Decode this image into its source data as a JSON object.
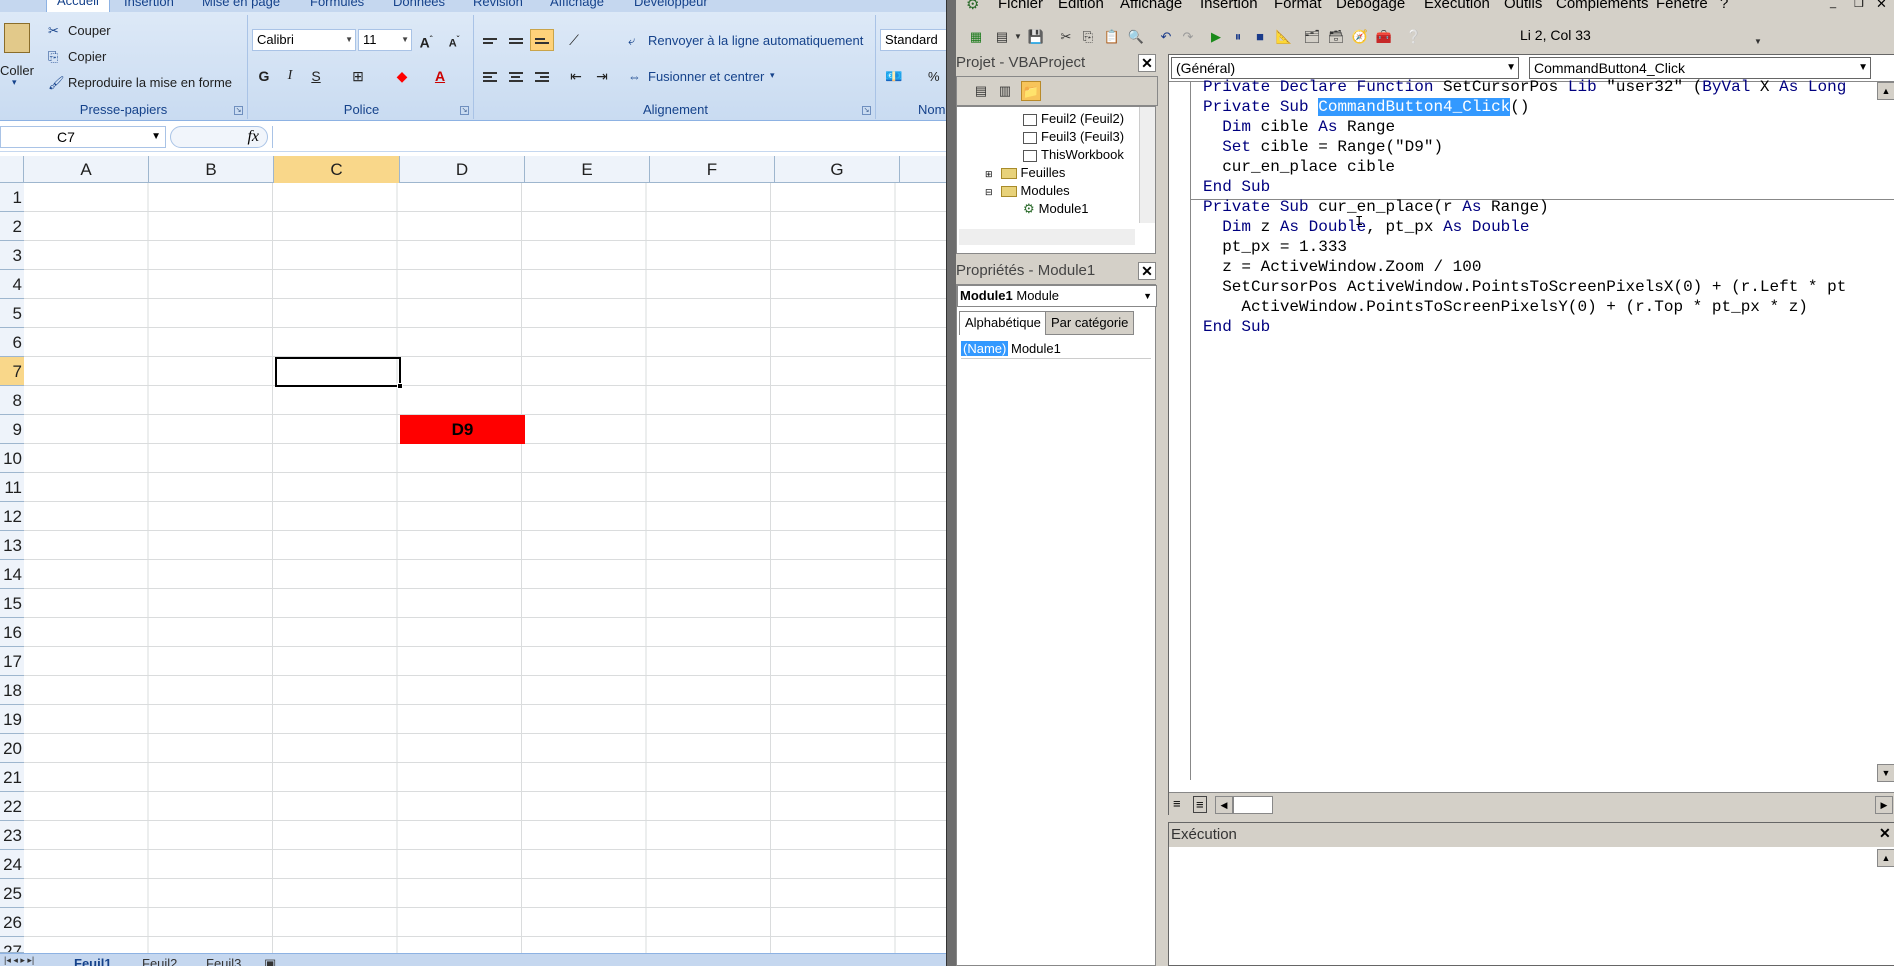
{
  "excel": {
    "ribbon_tabs": [
      "Accueil",
      "Insertion",
      "Mise en page",
      "Formules",
      "Données",
      "Révision",
      "Affichage",
      "Développeur"
    ],
    "clipboard": {
      "paste": "Coller",
      "cut": "Couper",
      "copy": "Copier",
      "format_painter": "Reproduire la mise en forme",
      "label": "Presse-papiers"
    },
    "font": {
      "name": "Calibri",
      "size": "11",
      "bold": "G",
      "italic": "I",
      "underline": "S",
      "label": "Police"
    },
    "alignment": {
      "wrap": "Renvoyer à la ligne automatiquement",
      "merge": "Fusionner et centrer",
      "label": "Alignement"
    },
    "number": {
      "format": "Standard",
      "percent": "%",
      "label": "Nom"
    },
    "name_box": "C7",
    "fx": "fx",
    "columns": [
      "A",
      "B",
      "C",
      "D",
      "E",
      "F",
      "G"
    ],
    "rows": [
      "1",
      "2",
      "3",
      "4",
      "5",
      "6",
      "7",
      "8",
      "9",
      "10",
      "11",
      "12",
      "13",
      "14",
      "15",
      "16",
      "17",
      "18",
      "19",
      "20",
      "21",
      "22",
      "23",
      "24",
      "25",
      "26",
      "27"
    ],
    "cell_d9": "D9",
    "sheets": [
      "Feuil1",
      "Feuil2",
      "Feuil3"
    ]
  },
  "vbe": {
    "menu": [
      "Fichier",
      "Edition",
      "Affichage",
      "Insertion",
      "Format",
      "Débogage",
      "Exécution",
      "Outils",
      "Compléments",
      "Fenêtre",
      "?"
    ],
    "cursor_pos": "Li 2, Col 33",
    "project": {
      "title": "Projet - VBAProject",
      "items": [
        "Feuil2 (Feuil2)",
        "Feuil3 (Feuil3)",
        "ThisWorkbook",
        "Feuilles",
        "Modules",
        "Module1"
      ]
    },
    "properties": {
      "title": "Propriétés - Module1",
      "object_name": "Module1",
      "object_type": "Module",
      "tab_alpha": "Alphabétique",
      "tab_cat": "Par catégorie",
      "prop_name": "(Name)",
      "prop_value": "Module1"
    },
    "code": {
      "object_combo": "(Général)",
      "proc_combo": "CommandButton4_Click",
      "lines": [
        "Private Declare Function SetCursorPos Lib \"user32\" (ByVal X As Long",
        "Private Sub CommandButton4_Click()",
        "  Dim cible As Range",
        "  Set cible = Range(\"D9\")",
        "  cur_en_place cible",
        "End Sub",
        "Private Sub cur_en_place(r As Range)",
        "  Dim z As Double, pt_px As Double",
        "  pt_px = 1.333",
        "  z = ActiveWindow.Zoom / 100",
        "  SetCursorPos ActiveWindow.PointsToScreenPixelsX(0) + (r.Left * pt",
        "    ActiveWindow.PointsToScreenPixelsY(0) + (r.Top * pt_px * z)",
        "End Sub"
      ]
    },
    "exec_title": "Exécution"
  }
}
